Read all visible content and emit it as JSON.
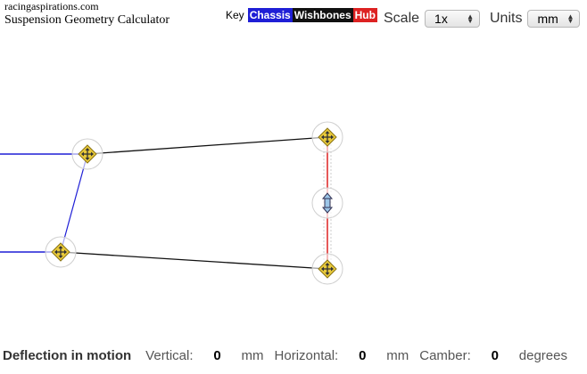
{
  "header": {
    "site": "racingaspirations.com",
    "title": "Suspension Geometry Calculator"
  },
  "key": {
    "label": "Key",
    "items": [
      {
        "label": "Chassis",
        "color": "#1f1fd6"
      },
      {
        "label": "Wishbones",
        "color": "#111111"
      },
      {
        "label": "Hub",
        "color": "#dd2222"
      }
    ]
  },
  "scale": {
    "label": "Scale",
    "value": "1x"
  },
  "units": {
    "label": "Units",
    "value": "mm"
  },
  "diagram": {
    "handle_icons": [
      "move-handle-icon",
      "vertical-move-handle-icon"
    ],
    "colors": {
      "chassis": "#1f1fd6",
      "wishbones": "#111111",
      "hub": "#dd2222",
      "handle": "#e8c93a"
    }
  },
  "footer": {
    "heading": "Deflection in motion",
    "vertical_label": "Vertical:",
    "vertical_value": "0",
    "vertical_unit": "mm",
    "horizontal_label": "Horizontal:",
    "horizontal_value": "0",
    "horizontal_unit": "mm",
    "camber_label": "Camber:",
    "camber_value": "0",
    "camber_unit": "degrees"
  }
}
